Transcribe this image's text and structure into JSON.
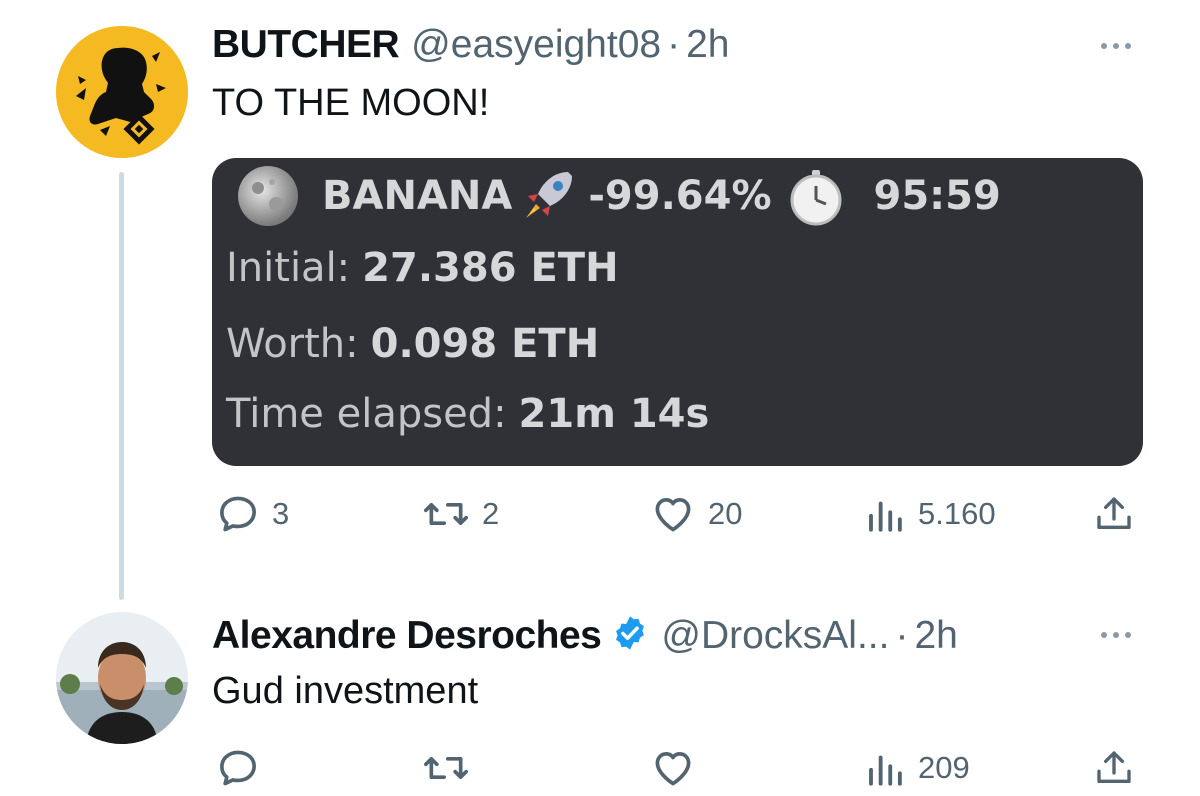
{
  "tweet1": {
    "name": "BUTCHER",
    "handle": "@easyeight08",
    "separator": "·",
    "time": "2h",
    "text": "TO THE MOON!",
    "avatar_icon": "butcher-avatar",
    "card": {
      "token": "BANANA",
      "change": "-99.64%",
      "timer": "95:59",
      "initial_label": "Initial:",
      "initial_value": "27.386 ETH",
      "worth_label": "Worth:",
      "worth_value": "0.098 ETH",
      "elapsed_label": "Time elapsed:",
      "elapsed_value": "21m 14s"
    },
    "stats": {
      "replies": "3",
      "retweets": "2",
      "likes": "20",
      "views": "5.160"
    }
  },
  "tweet2": {
    "name": "Alexandre Desroches",
    "handle": "@DrocksAl...",
    "separator": "·",
    "time": "2h",
    "text": "Gud investment",
    "verified": true,
    "stats": {
      "views": "209"
    }
  },
  "colors": {
    "text": "#0f1419",
    "secondary": "#536471",
    "verified": "#1d9bf0",
    "card_bg": "#2f3136",
    "avatar_yellow": "#f5b921"
  }
}
